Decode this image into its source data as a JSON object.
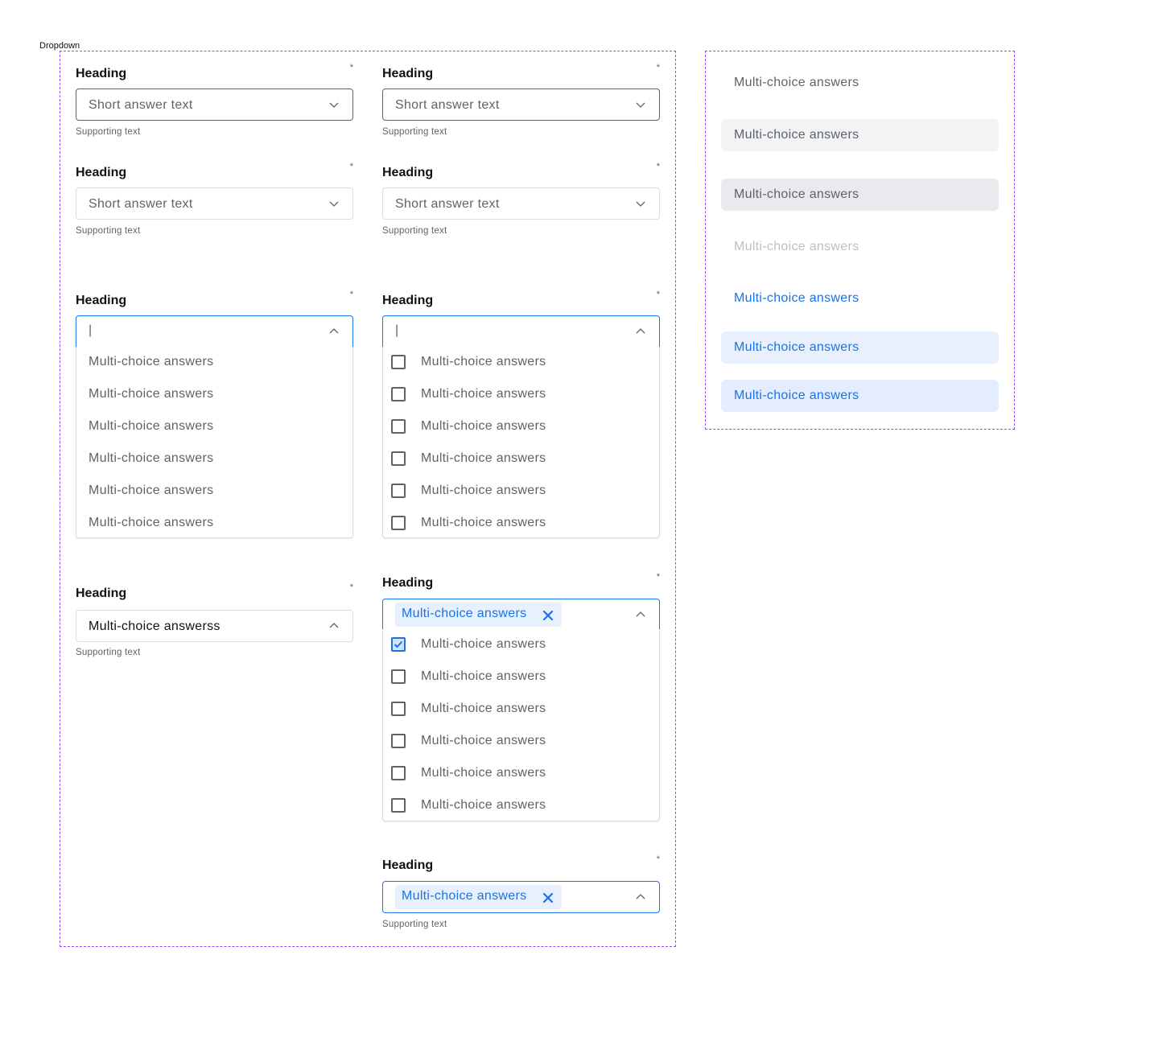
{
  "frame_label": "Dropdown",
  "colors": {
    "frame_border": "#9747FF",
    "accent": "#1a73e8",
    "chip_bg": "#e8f0fe",
    "text_muted": "#5f6368"
  },
  "icons": {
    "chevron_down": "chevron-down-icon",
    "chevron_up": "chevron-up-icon",
    "close": "close-icon",
    "check": "checkbox-check-icon"
  },
  "fields": {
    "f1": {
      "heading": "Heading",
      "required": "*",
      "value": "Short answer text",
      "support": "Supporting text"
    },
    "f2": {
      "heading": "Heading",
      "required": "*",
      "value": "Short answer text",
      "support": "Supporting text"
    },
    "f3": {
      "heading": "Heading",
      "required": "*",
      "value": "Short answer text",
      "support": "Supporting text"
    },
    "f4": {
      "heading": "Heading",
      "required": "*",
      "value": "Short answer text",
      "support": "Supporting text"
    },
    "f5": {
      "heading": "Heading",
      "required": "*",
      "cursor": "|",
      "options": [
        "Multi-choice answers",
        "Multi-choice answers",
        "Multi-choice answers",
        "Multi-choice answers",
        "Multi-choice answers",
        "Multi-choice answers"
      ]
    },
    "f6": {
      "heading": "Heading",
      "required": "*",
      "cursor": "|",
      "options": [
        "Multi-choice answers",
        "Multi-choice answers",
        "Multi-choice answers",
        "Multi-choice answers",
        "Multi-choice answers",
        "Multi-choice answers"
      ]
    },
    "f7": {
      "heading": "Heading",
      "required": "*",
      "value": "Multi-choice answerss",
      "support": "Supporting text"
    },
    "f8": {
      "heading": "Heading",
      "required": "*",
      "chip": "Multi-choice answers",
      "options": [
        "Multi-choice answers",
        "Multi-choice answers",
        "Multi-choice answers",
        "Multi-choice answers",
        "Multi-choice answers",
        "Multi-choice answers"
      ]
    },
    "f9": {
      "heading": "Heading",
      "required": "*",
      "chip": "Multi-choice answers",
      "support": "Supporting text"
    }
  },
  "option_states": [
    "Multi-choice answers",
    "Multi-choice answers",
    "Multi-choice answers",
    "Multi-choice answers",
    "Multi-choice answers",
    "Multi-choice answers",
    "Multi-choice answers"
  ]
}
